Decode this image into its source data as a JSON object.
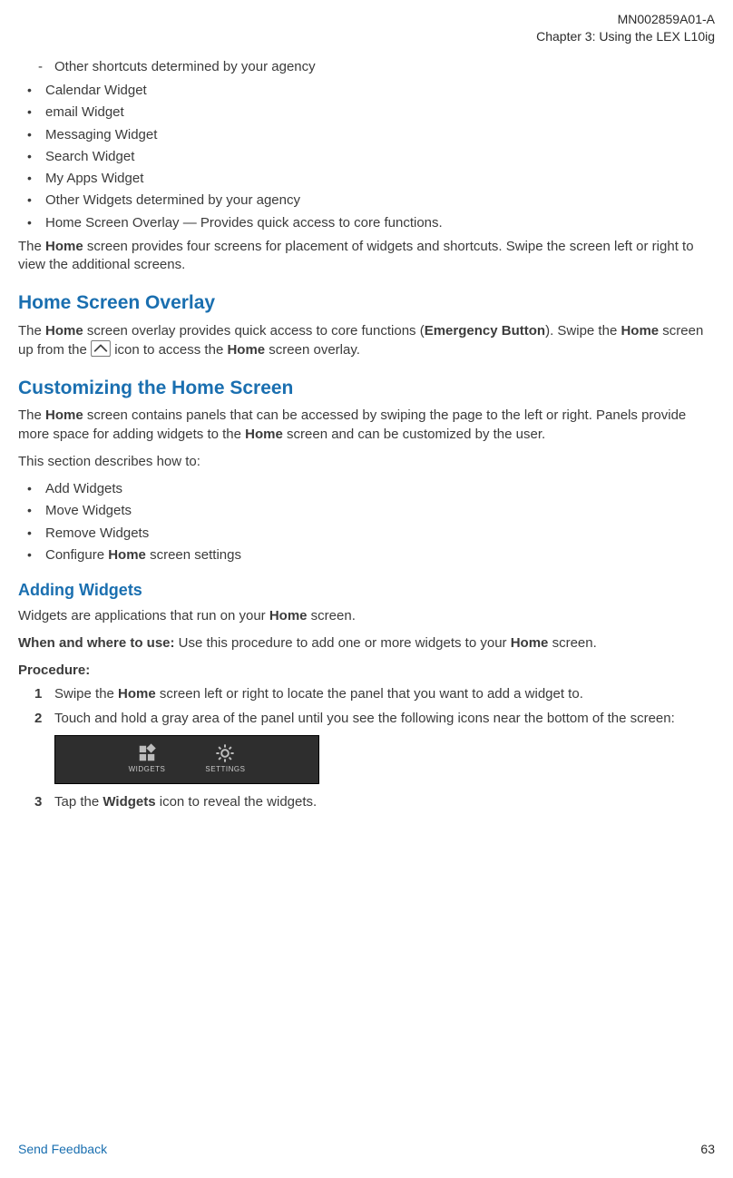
{
  "header": {
    "doc_id": "MN002859A01-A",
    "chapter": "Chapter 3:  Using the LEX L10ig"
  },
  "dash_items": [
    "Other shortcuts determined by your agency"
  ],
  "bullets1": [
    "Calendar Widget",
    "email Widget",
    "Messaging Widget",
    "Search Widget",
    "My Apps Widget",
    "Other Widgets determined by your agency",
    "Home Screen Overlay — Provides quick access to core functions."
  ],
  "paragraph_home_screens": {
    "pre": "The ",
    "b1": "Home",
    "post": " screen provides four screens for placement of widgets and shortcuts. Swipe the screen left or right to view the additional screens."
  },
  "overlay": {
    "title": "Home Screen Overlay",
    "pre1": "The ",
    "b_home1": "Home",
    "mid1": " screen overlay provides quick access to core functions (",
    "b_emerg": "Emergency Button",
    "mid2": "). Swipe the ",
    "b_home2": "Home",
    "mid3": " screen up from the ",
    "mid4": " icon to access the ",
    "b_home3": "Home",
    "post": " screen overlay."
  },
  "customize": {
    "title": "Customizing the Home Screen",
    "p1_pre": "The ",
    "p1_b1": "Home",
    "p1_mid": " screen contains panels that can be accessed by swiping the page to the left or right. Panels provide more space for adding widgets to the ",
    "p1_b2": "Home",
    "p1_post": " screen and can be customized by the user.",
    "p2": "This section describes how to:",
    "items": [
      {
        "text": "Add Widgets"
      },
      {
        "text": "Move Widgets"
      },
      {
        "text": "Remove Widgets"
      },
      {
        "pre": "Configure ",
        "b": "Home",
        "post": " screen settings"
      }
    ]
  },
  "adding": {
    "title": "Adding Widgets",
    "p1_pre": "Widgets are applications that run on your ",
    "p1_b": "Home",
    "p1_post": " screen.",
    "p2_label": "When and where to use:",
    "p2_pre": " Use this procedure to add one or more widgets to your ",
    "p2_b": "Home",
    "p2_post": " screen.",
    "proc_label": "Procedure:",
    "steps": {
      "s1_pre": "Swipe the ",
      "s1_b": "Home",
      "s1_post": " screen left or right to locate the panel that you want to add a widget to.",
      "s2": "Touch and hold a gray area of the panel until you see the following icons near the bottom of the screen:",
      "s3_pre": "Tap the ",
      "s3_b": "Widgets",
      "s3_post": " icon to reveal the widgets."
    },
    "toolbar": {
      "widgets": "WIDGETS",
      "settings": "SETTINGS"
    }
  },
  "footer": {
    "send": "Send Feedback",
    "page": "63"
  }
}
